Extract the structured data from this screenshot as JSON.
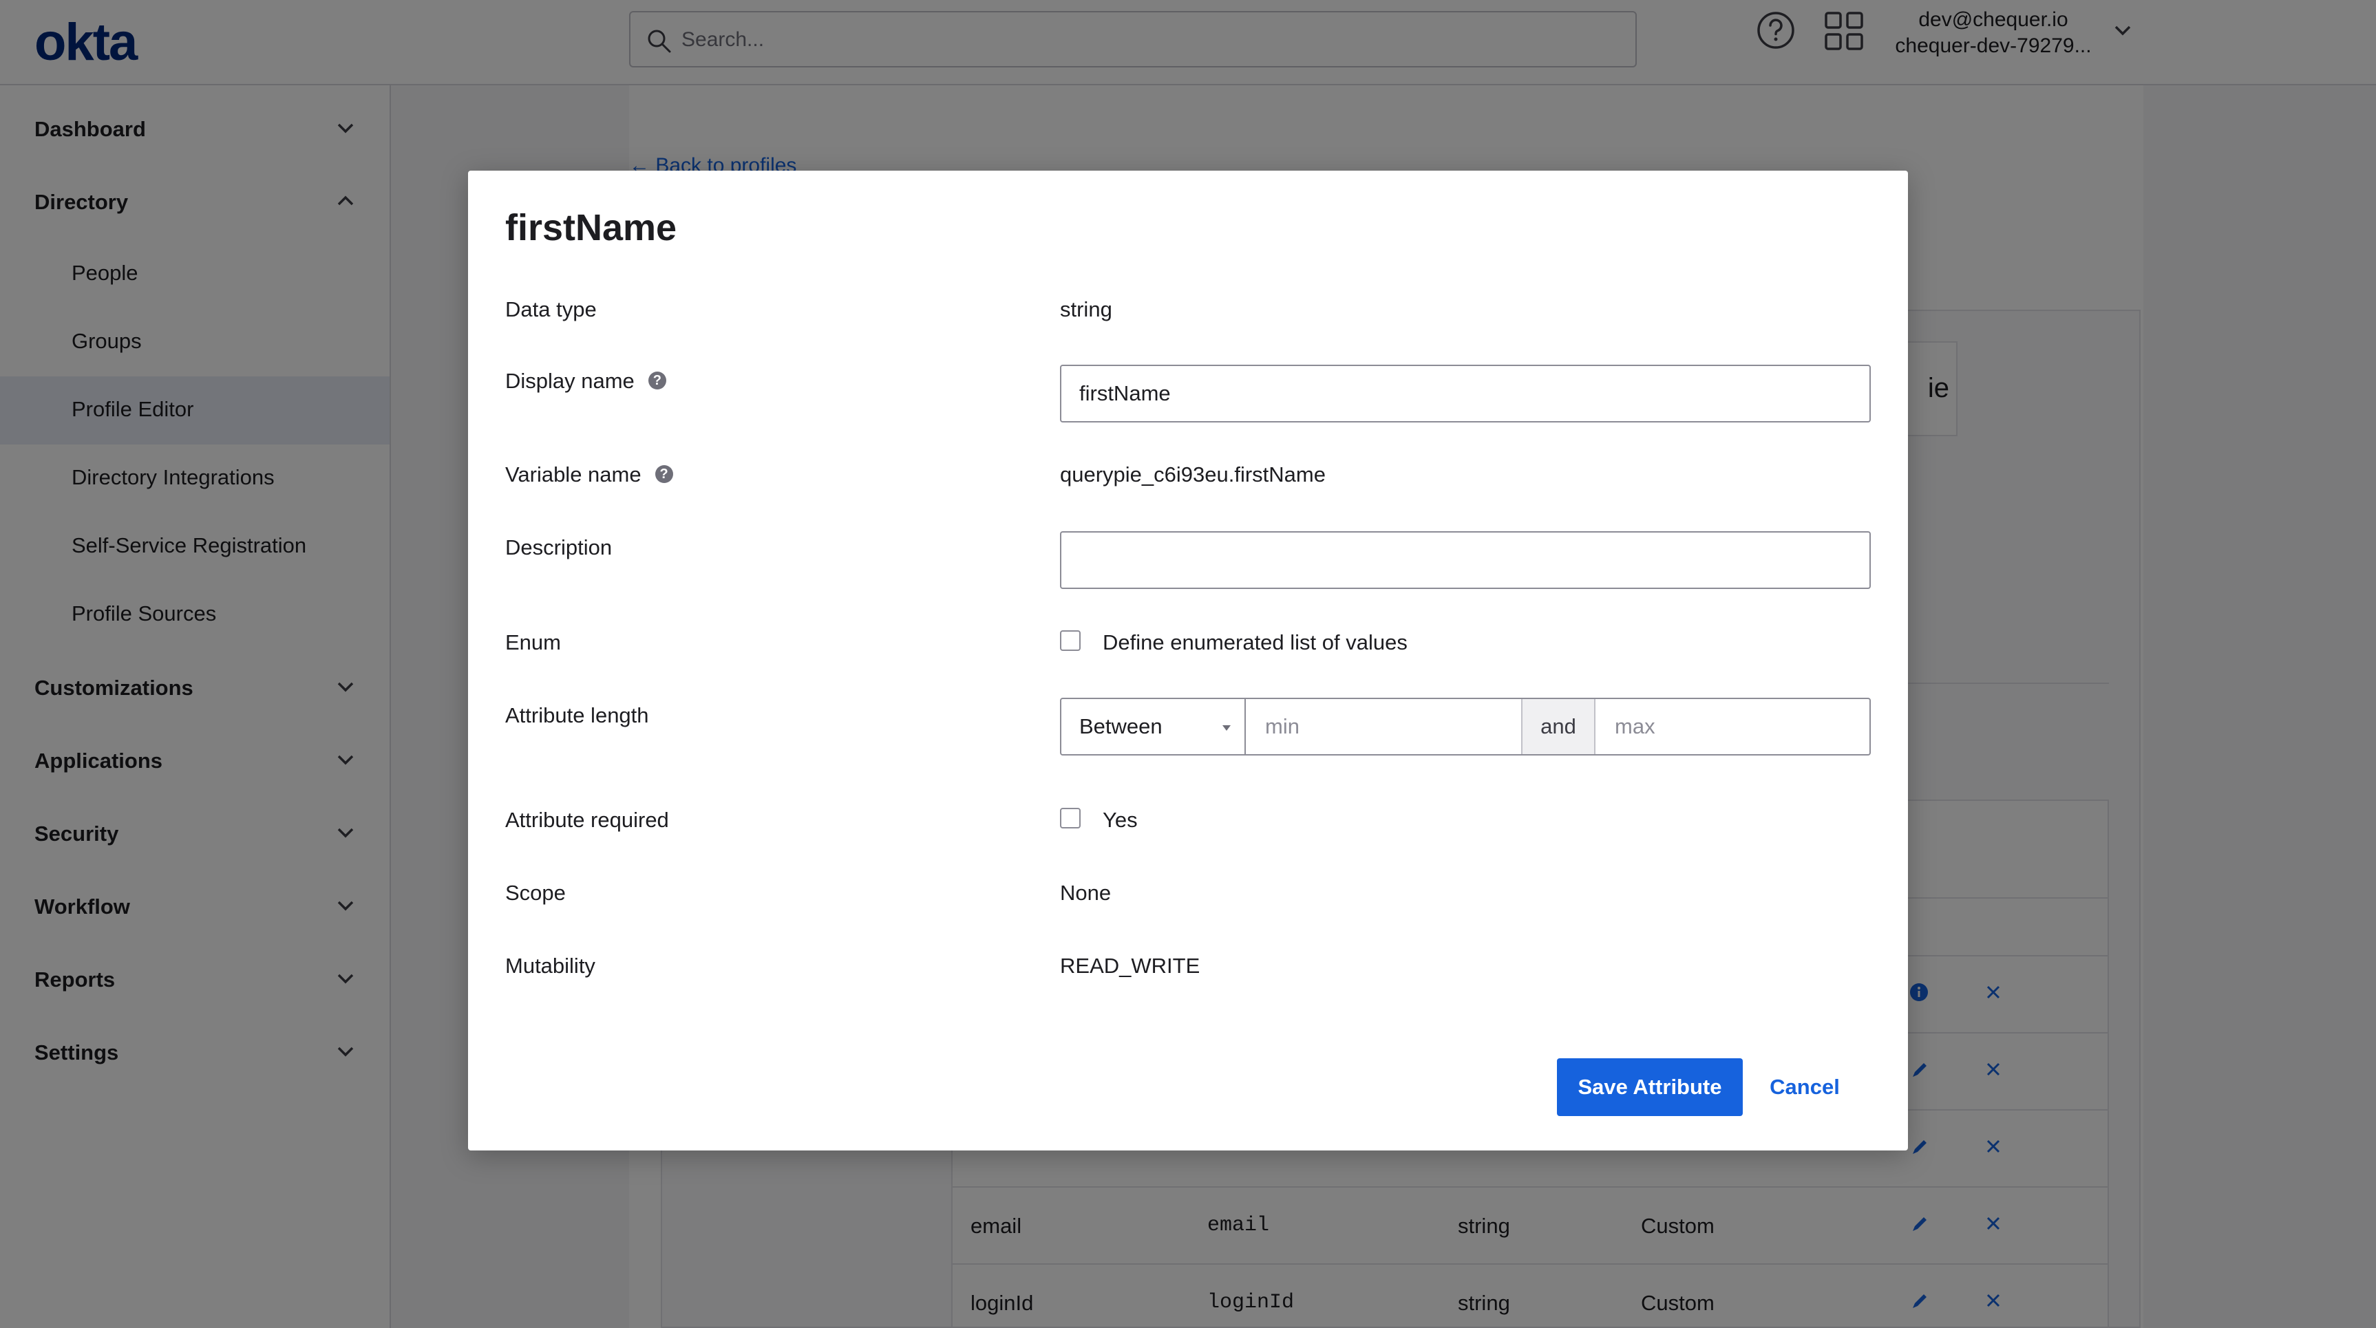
{
  "header": {
    "logo_text": "okta",
    "search_placeholder": "Search...",
    "user_email": "dev@chequer.io",
    "user_org": "chequer-dev-79279..."
  },
  "sidebar": {
    "sections": [
      {
        "label": "Dashboard",
        "expanded": false
      },
      {
        "label": "Directory",
        "expanded": true
      },
      {
        "label": "Customizations",
        "expanded": false
      },
      {
        "label": "Applications",
        "expanded": false
      },
      {
        "label": "Security",
        "expanded": false
      },
      {
        "label": "Workflow",
        "expanded": false
      },
      {
        "label": "Reports",
        "expanded": false
      },
      {
        "label": "Settings",
        "expanded": false
      }
    ],
    "directory_items": [
      {
        "label": "People"
      },
      {
        "label": "Groups"
      },
      {
        "label": "Profile Editor",
        "active": true
      },
      {
        "label": "Directory Integrations"
      },
      {
        "label": "Self-Service Registration"
      },
      {
        "label": "Profile Sources"
      }
    ]
  },
  "background": {
    "back_link": "← Back to profiles",
    "tab_fragment": "ie",
    "rows": [
      {
        "display_name": "email",
        "variable": "email",
        "type": "string",
        "attribute": "Custom"
      },
      {
        "display_name": "loginId",
        "variable": "loginId",
        "type": "string",
        "attribute": "Custom"
      }
    ]
  },
  "modal": {
    "title": "firstName",
    "labels": {
      "data_type": "Data type",
      "display_name": "Display name",
      "variable_name": "Variable name",
      "description": "Description",
      "enum": "Enum",
      "attribute_length": "Attribute length",
      "attribute_required": "Attribute required",
      "scope": "Scope",
      "mutability": "Mutability"
    },
    "values": {
      "data_type": "string",
      "display_name": "firstName",
      "variable_name": "querypie_c6i93eu.firstName",
      "description": "",
      "enum_checkbox_label": "Define enumerated list of values",
      "enum_checked": false,
      "length_operator": "Between",
      "length_min_placeholder": "min",
      "length_and": "and",
      "length_max_placeholder": "max",
      "required_checkbox_label": "Yes",
      "required_checked": false,
      "scope": "None",
      "mutability": "READ_WRITE"
    },
    "help_glyph": "?",
    "buttons": {
      "save": "Save Attribute",
      "cancel": "Cancel"
    }
  },
  "colors": {
    "accent": "#1662dd",
    "logo": "#00297a",
    "overlay": "rgba(0,0,0,0.5)"
  }
}
